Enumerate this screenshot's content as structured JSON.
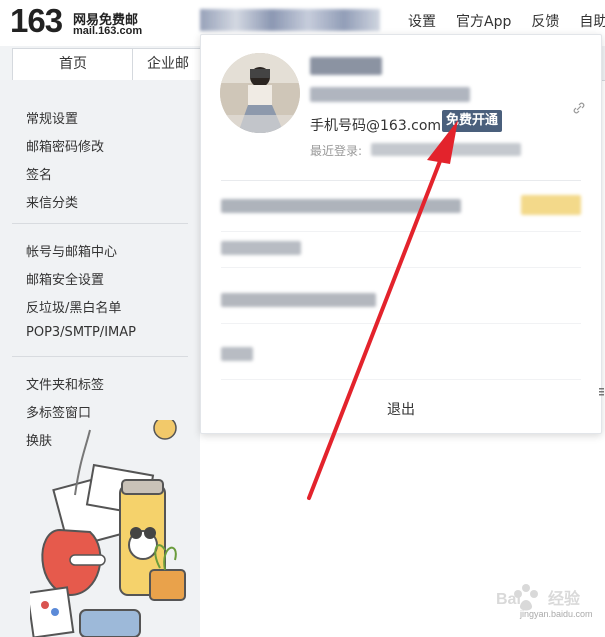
{
  "logo": {
    "number": "163",
    "title": "网易免费邮",
    "domain": "mail.163.com"
  },
  "top_nav": {
    "links": [
      "设置",
      "官方App",
      "反馈",
      "自助"
    ]
  },
  "tabs": [
    {
      "label": "首页"
    },
    {
      "label": "企业邮"
    }
  ],
  "sidebar": {
    "groups": [
      [
        "常规设置",
        "邮箱密码修改",
        "签名",
        "来信分类"
      ],
      [
        "帐号与邮箱中心",
        "邮箱安全设置",
        "反垃圾/黑白名单",
        "POP3/SMTP/IMAP"
      ],
      [
        "文件夹和标签",
        "多标签窗口",
        "换肤"
      ]
    ]
  },
  "account_panel": {
    "phone_label": "手机号码@163.com",
    "free_open_label": "免费开通",
    "last_login_label": "最近登录:",
    "logout_label": "退出"
  },
  "watermark": {
    "text": "Bai 经验",
    "url": "jingyan.baidu.com"
  },
  "colors": {
    "badge_bg": "#4a5f7c",
    "arrow": "#e3232c",
    "sidebar_bg": "#f0f2f4"
  }
}
